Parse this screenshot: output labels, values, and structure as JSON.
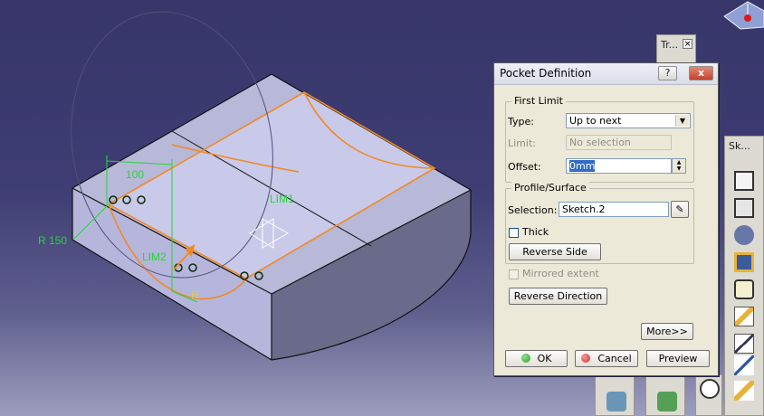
{
  "viewport": {
    "dimension_100": "100",
    "radius_label": "R 150",
    "lim1_label": "LIM1",
    "lim2_label": "LIM2",
    "h_label": "H"
  },
  "dialog": {
    "title": "Pocket Definition",
    "help_label": "?",
    "close_label": "x",
    "first_limit": {
      "legend": "First Limit",
      "type_label": "Type:",
      "type_value": "Up to next",
      "limit_label": "Limit:",
      "limit_value": "No selection",
      "offset_label": "Offset:",
      "offset_value": "0mm"
    },
    "profile": {
      "legend": "Profile/Surface",
      "selection_label": "Selection:",
      "selection_value": "Sketch.2",
      "thick_label": "Thick",
      "reverse_side_label": "Reverse Side"
    },
    "mirrored_extent_label": "Mirrored extent",
    "reverse_direction_label": "Reverse Direction",
    "more_label": "More>>",
    "ok_label": "OK",
    "cancel_label": "Cancel",
    "preview_label": "Preview"
  },
  "toolbars": {
    "tr_title": "Tr...",
    "sk_title": "Sk..."
  },
  "colors": {
    "accent_orange": "#f08a24",
    "dimension_green": "#27d43a",
    "ok_green": "#2ea02e",
    "cancel_red": "#d42a2a"
  }
}
